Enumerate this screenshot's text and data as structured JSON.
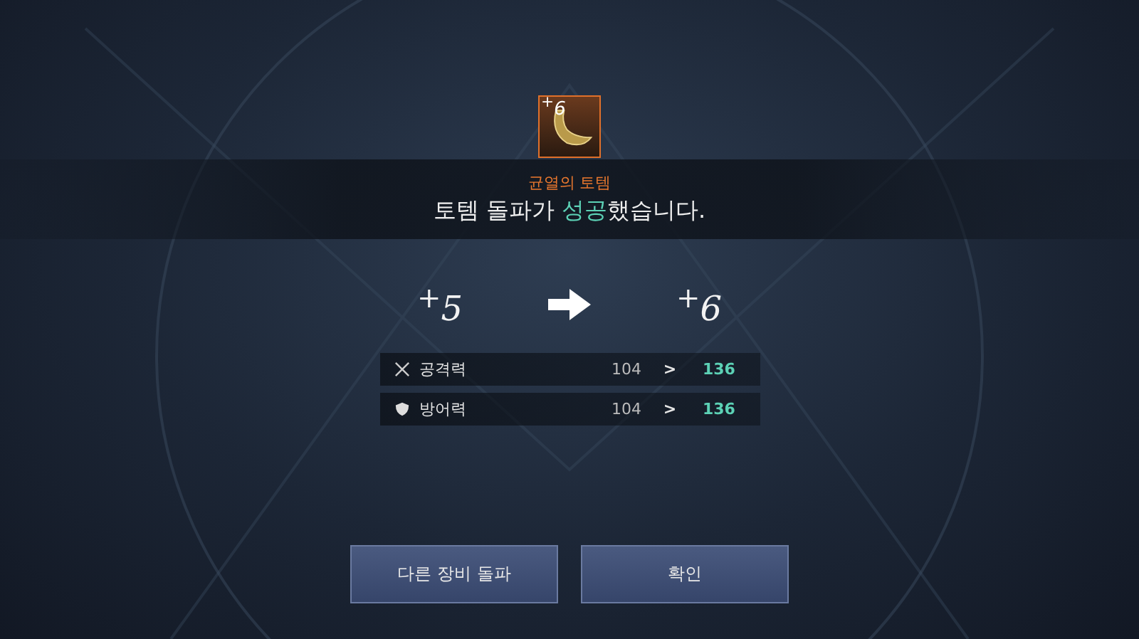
{
  "item": {
    "enhance_badge": "$^{+}$6",
    "name": "균열의 토템",
    "message": "토템 돌파가 **성공**했습니다."
  },
  "upgrade": {
    "from": "$^{+}$5",
    "to": "$^{+}$6"
  },
  "stats": [
    {
      "kind": "attack",
      "label": "공격력",
      "before": "104",
      "separator": ">",
      "after": "136"
    },
    {
      "kind": "defense",
      "label": "방어력",
      "before": "104",
      "separator": ">",
      "after": "136"
    }
  ],
  "buttons": [
    "다른 장비 돌파",
    "확인"
  ]
}
